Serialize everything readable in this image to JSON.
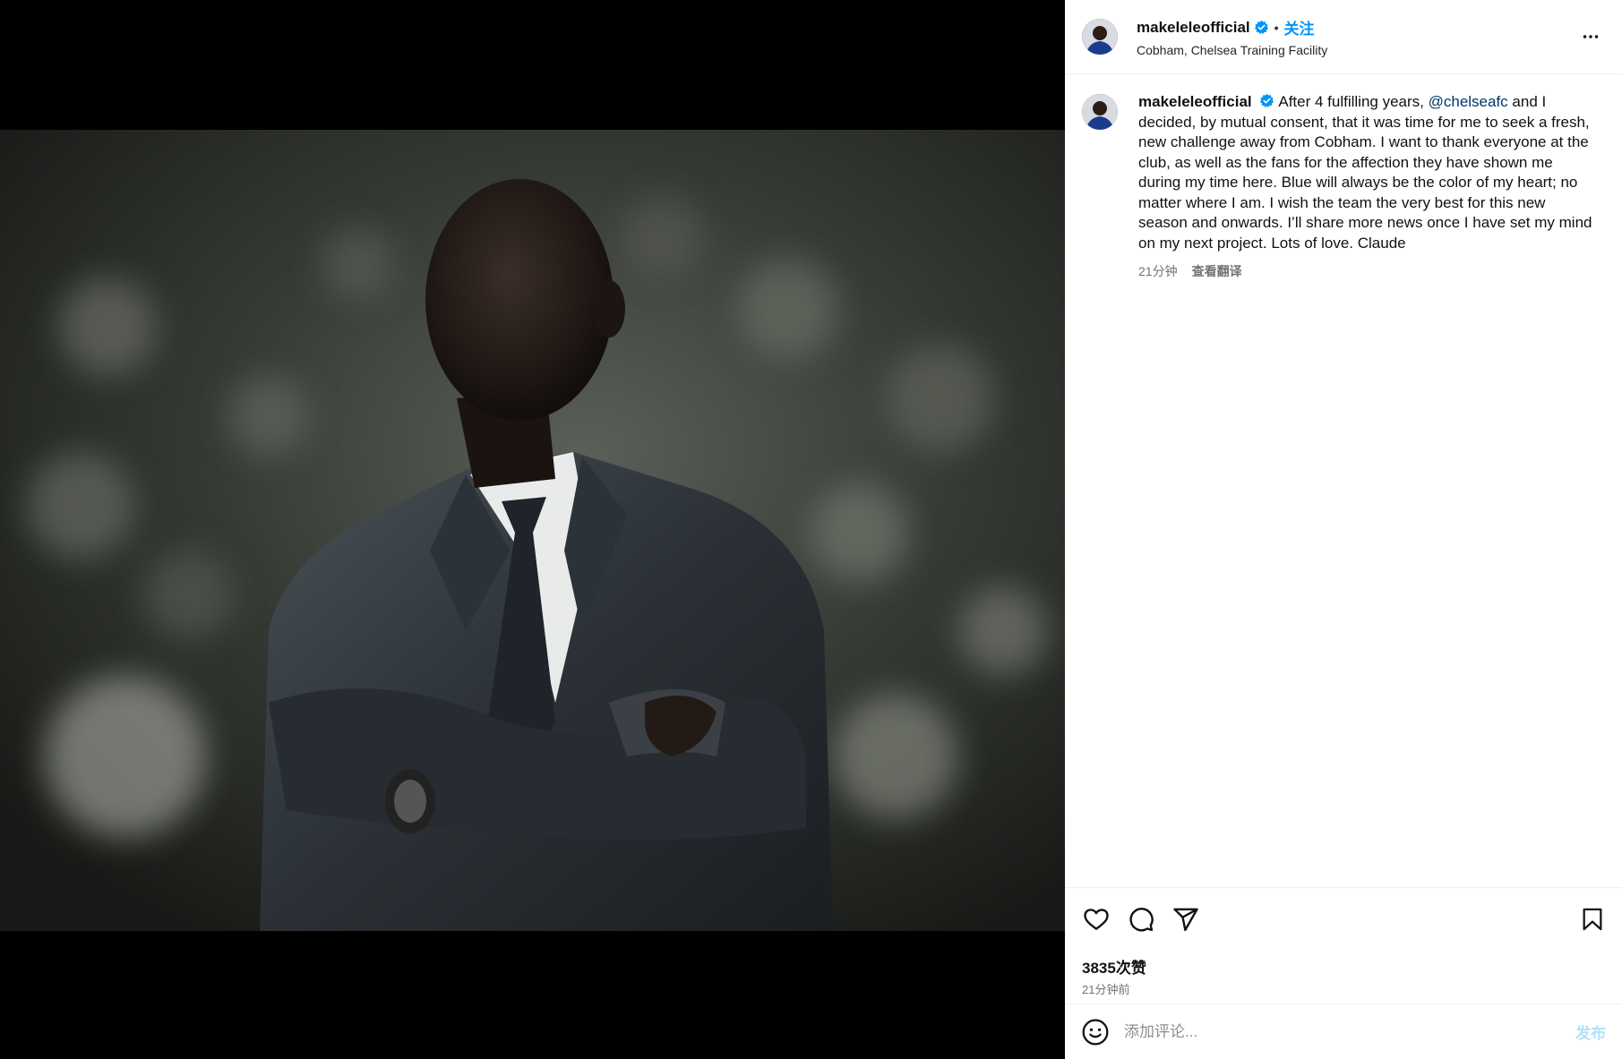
{
  "post": {
    "image_alt": "Portrait of man in dark suit with arms crossed"
  },
  "header": {
    "username": "makeleleofficial",
    "separator": "•",
    "follow_label": "关注",
    "location": "Cobham, Chelsea Training Facility",
    "more_icon": "more-horizontal-icon"
  },
  "caption": {
    "username": "makeleleofficial",
    "text_before_mention": "After 4 fulfilling years, ",
    "mention": "@chelseafc",
    "text_after_mention": " and I decided, by mutual consent, that it was time for me to seek a fresh, new challenge away from Cobham. I want to thank everyone at the club, as well as the fans for the affection they have shown me during my time here. Blue will always be the color of my heart; no matter where I am. I wish the team the very best for this new season and onwards. I’ll share more news once I have set my mind on my next project. Lots of love. Claude",
    "time": "21分钟",
    "translate_label": "查看翻译"
  },
  "actions": {
    "like_icon": "heart-icon",
    "comment_icon": "comment-icon",
    "share_icon": "share-icon",
    "save_icon": "bookmark-icon"
  },
  "likes": {
    "count_label": "3835次赞",
    "time_label": "21分钟前"
  },
  "comment": {
    "placeholder": "添加评论...",
    "post_label": "发布",
    "emoji_icon": "emoji-icon"
  },
  "colors": {
    "accent": "#0095f6",
    "mention": "#00376b",
    "muted": "#737373",
    "post_disabled": "#b2dffc"
  }
}
